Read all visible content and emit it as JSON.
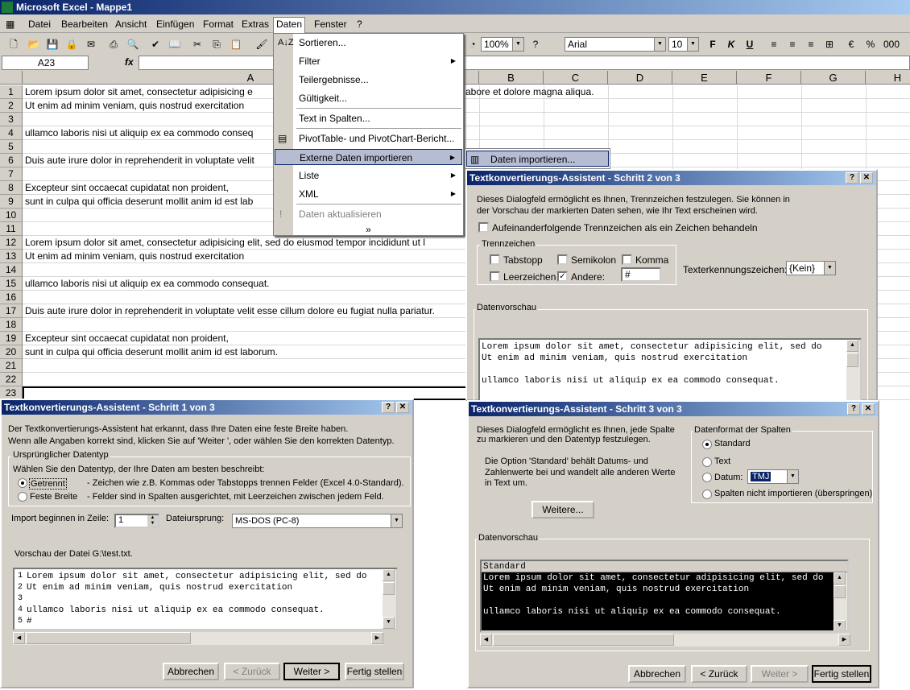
{
  "app": {
    "title": "Microsoft Excel - Mappe1"
  },
  "menubar": [
    "Datei",
    "Bearbeiten",
    "Ansicht",
    "Einfügen",
    "Format",
    "Extras",
    "Daten",
    "Fenster",
    "?"
  ],
  "toolbar": {
    "zoom": "100%",
    "font": "Arial",
    "size": "10",
    "bold": "F",
    "italic": "K",
    "underline": "U",
    "percent": "%",
    "thousands": "000"
  },
  "formula": {
    "cellref": "A23",
    "fx": "fx"
  },
  "columns": [
    "A",
    "B",
    "C",
    "D",
    "E",
    "F",
    "G",
    "H"
  ],
  "rows": [
    {
      "n": "1",
      "text": "Lorem ipsum dolor sit amet, consectetur adipisicing e"
    },
    {
      "n": "2",
      "text": "Ut enim ad minim veniam, quis nostrud exercitation"
    },
    {
      "n": "3",
      "text": ""
    },
    {
      "n": "4",
      "text": "ullamco laboris nisi ut aliquip ex ea commodo conseq"
    },
    {
      "n": "5",
      "text": ""
    },
    {
      "n": "6",
      "text": "Duis aute irure dolor in reprehenderit in voluptate velit"
    },
    {
      "n": "7",
      "text": ""
    },
    {
      "n": "8",
      "text": "Excepteur sint occaecat cupidatat non proident,"
    },
    {
      "n": "9",
      "text": "sunt in culpa qui officia deserunt mollit anim id est lab"
    },
    {
      "n": "10",
      "text": ""
    },
    {
      "n": "11",
      "text": ""
    },
    {
      "n": "12",
      "text": "Lorem ipsum dolor sit amet, consectetur adipisicing elit, sed do eiusmod tempor incididunt ut l"
    },
    {
      "n": "13",
      "text": "Ut enim ad minim veniam, quis nostrud exercitation"
    },
    {
      "n": "14",
      "text": ""
    },
    {
      "n": "15",
      "text": "ullamco laboris nisi ut aliquip ex ea commodo consequat."
    },
    {
      "n": "16",
      "text": ""
    },
    {
      "n": "17",
      "text": "Duis aute irure dolor in reprehenderit in voluptate velit esse cillum dolore eu fugiat nulla pariatur."
    },
    {
      "n": "18",
      "text": ""
    },
    {
      "n": "19",
      "text": "Excepteur sint occaecat cupidatat non proident,"
    },
    {
      "n": "20",
      "text": "sunt in culpa qui officia deserunt mollit anim id est laborum."
    },
    {
      "n": "21",
      "text": ""
    },
    {
      "n": "22",
      "text": ""
    },
    {
      "n": "23",
      "text": ""
    }
  ],
  "row1_overflow": "abore et dolore magna aliqua.",
  "datenmenu": {
    "items": [
      "Sortieren...",
      "Filter",
      "Teilergebnisse...",
      "Gültigkeit...",
      "Text in Spalten...",
      "PivotTable- und PivotChart-Bericht...",
      "Externe Daten importieren",
      "Liste",
      "XML",
      "Daten aktualisieren"
    ],
    "expand": "»"
  },
  "submenu": {
    "label": "Daten importieren..."
  },
  "dlg2": {
    "title": "Textkonvertierungs-Assistent - Schritt 2 von 3",
    "desc1": "Dieses Dialogfeld ermöglicht es Ihnen, Trennzeichen festzulegen. Sie können in",
    "desc2": "der Vorschau der markierten Daten sehen, wie Ihr Text erscheinen wird.",
    "consecutive": "Aufeinanderfolgende Trennzeichen als ein Zeichen behandeln",
    "group": "Trennzeichen",
    "tab": "Tabstopp",
    "semicolon": "Semikolon",
    "comma": "Komma",
    "space": "Leerzeichen",
    "other": "Andere:",
    "other_value": "#",
    "qualifier_label": "Texterkennungszeichen:",
    "qualifier_value": "{Kein}",
    "preview_label": "Datenvorschau",
    "preview": [
      "Lorem ipsum dolor sit amet, consectetur adipisicing elit, sed do",
      "Ut enim ad minim veniam, quis nostrud exercitation",
      "",
      "ullamco laboris nisi ut aliquip ex ea commodo consequat."
    ]
  },
  "dlg1": {
    "title": "Textkonvertierungs-Assistent - Schritt 1 von 3",
    "desc1": "Der Textkonvertierungs-Assistent hat erkannt, dass Ihre Daten eine feste Breite haben.",
    "desc2": "Wenn alle Angaben korrekt sind, klicken Sie auf 'Weiter ', oder wählen Sie den korrekten Datentyp.",
    "group": "Ursprünglicher Datentyp",
    "choose": "Wählen Sie den Datentyp, der Ihre Daten am besten beschreibt:",
    "opt1": "Getrennt",
    "opt1_desc": "- Zeichen wie z.B. Kommas oder Tabstopps trennen Felder (Excel 4.0-Standard).",
    "opt2": "Feste Breite",
    "opt2_desc": "- Felder sind in Spalten ausgerichtet, mit Leerzeichen zwischen jedem Feld.",
    "startrow_label": "Import beginnen in Zeile:",
    "startrow_value": "1",
    "origin_label": "Dateiursprung:",
    "origin_value": "MS-DOS (PC-8)",
    "preview_label": "Vorschau der Datei G:\\test.txt.",
    "preview_nums": [
      "1",
      "2",
      "3",
      "4",
      "5"
    ],
    "preview": [
      "Lorem ipsum dolor sit amet, consectetur adipisicing elit, sed do",
      "Ut enim ad minim veniam, quis nostrud exercitation",
      "",
      "ullamco laboris nisi ut aliquip ex ea commodo consequat.",
      "#"
    ],
    "cancel": "Abbrechen",
    "back": "< Zurück",
    "next": "Weiter >",
    "finish": "Fertig stellen"
  },
  "dlg3": {
    "title": "Textkonvertierungs-Assistent - Schritt 3 von 3",
    "desc1": "Dieses Dialogfeld ermöglicht es Ihnen, jede Spalte",
    "desc2": "zu markieren und den Datentyp festzulegen.",
    "info1": "Die Option 'Standard' behält Datums- und",
    "info2": "Zahlenwerte bei und wandelt alle anderen Werte",
    "info3": "in Text um.",
    "more": "Weitere...",
    "group": "Datenformat der Spalten",
    "standard": "Standard",
    "text": "Text",
    "date": "Datum:",
    "date_value": "TMJ",
    "skip": "Spalten nicht importieren (überspringen)",
    "preview_label": "Datenvorschau",
    "col_header": "Standard",
    "preview": [
      "Lorem ipsum dolor sit amet, consectetur adipisicing elit, sed do",
      "Ut enim ad minim veniam, quis nostrud exercitation",
      "",
      "ullamco laboris nisi ut aliquip ex ea commodo consequat."
    ],
    "cancel": "Abbrechen",
    "back": "< Zurück",
    "next": "Weiter >",
    "finish": "Fertig stellen"
  }
}
